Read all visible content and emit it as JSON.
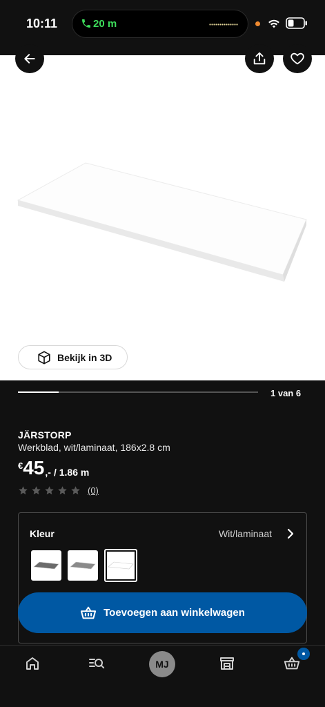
{
  "status_bar": {
    "time": "10:11",
    "call_duration": "20 m"
  },
  "image": {
    "view_3d_label": "Bekijk in 3D",
    "pager_label": "1 van 6",
    "pager_progress": 0.17
  },
  "product": {
    "name": "JÄRSTORP",
    "description": "Werkblad, wit/laminaat, 186x2.8 cm",
    "price_currency": "€",
    "price_main": "45",
    "price_suffix": ",-",
    "price_unit": "/ 1.86 m",
    "rating_stars": 0,
    "rating_max": 5,
    "review_count": "(0)"
  },
  "color_selector": {
    "label": "Kleur",
    "value": "Wit/laminaat",
    "swatches": [
      {
        "name": "grey",
        "color": "#6b6b6b"
      },
      {
        "name": "grey-light",
        "color": "#8a8a8a"
      },
      {
        "name": "white",
        "color": "#ffffff"
      }
    ],
    "selected_index": 2
  },
  "cta": {
    "add_to_cart_label": "Toevoegen aan winkelwagen"
  },
  "bottom_nav": {
    "profile_initials": "MJ"
  },
  "colors": {
    "accent": "#0058a3",
    "background": "#111111",
    "call_green": "#3ddc5b"
  }
}
